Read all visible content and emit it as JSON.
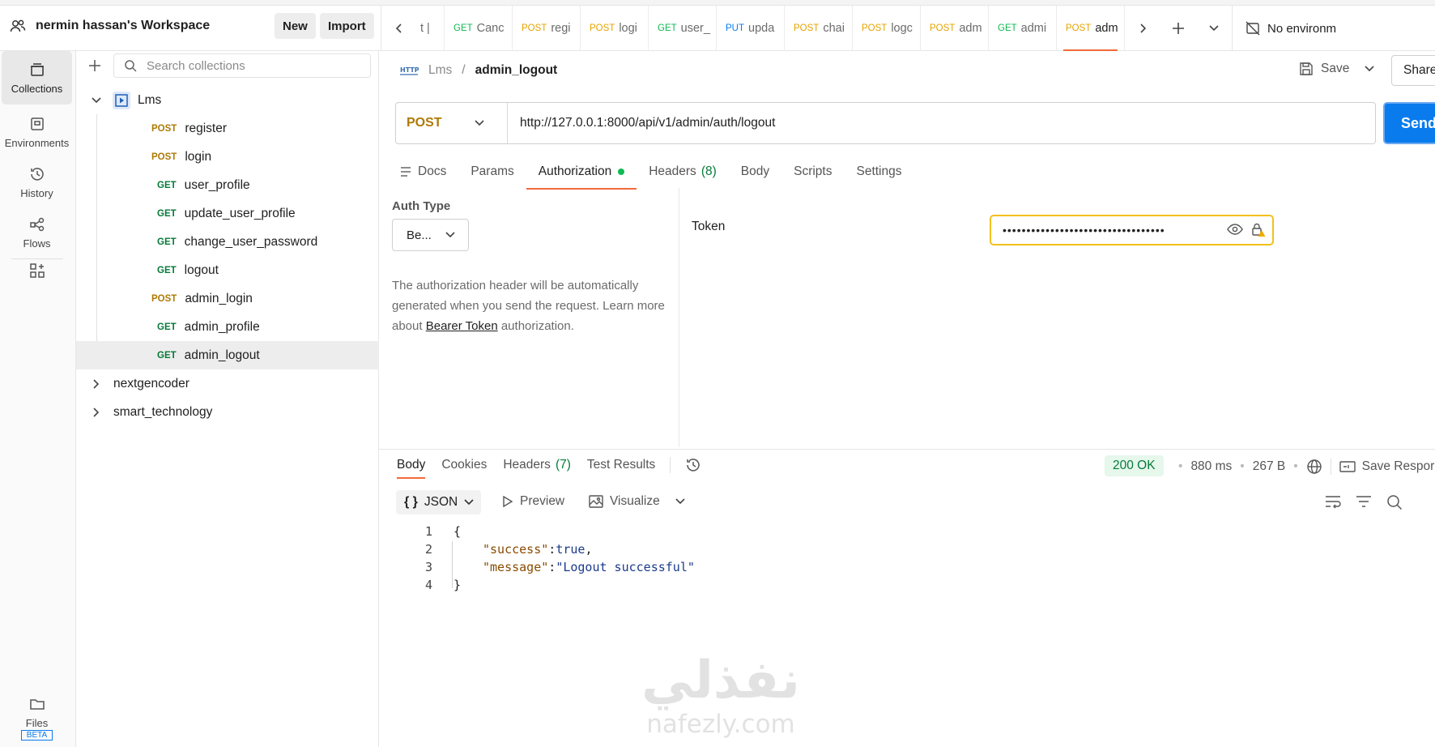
{
  "workspace": {
    "name": "nermin hassan's Workspace",
    "new_label": "New",
    "import_label": "Import"
  },
  "tabs": [
    {
      "method": "",
      "title": "t |"
    },
    {
      "method": "GET",
      "title": "Canc"
    },
    {
      "method": "POST",
      "title": "regi",
      "dot": true
    },
    {
      "method": "POST",
      "title": "logi",
      "dot": true
    },
    {
      "method": "GET",
      "title": "user_",
      "dot": true
    },
    {
      "method": "PUT",
      "title": "upda",
      "dot": true
    },
    {
      "method": "POST",
      "title": "chai",
      "dot": true
    },
    {
      "method": "POST",
      "title": "logc",
      "dot": true
    },
    {
      "method": "POST",
      "title": "adm"
    },
    {
      "method": "GET",
      "title": "admi",
      "dot": true
    },
    {
      "method": "POST",
      "title": "adm",
      "dot": true,
      "active": true
    }
  ],
  "environment": {
    "label": "No environm"
  },
  "rail": {
    "collections": "Collections",
    "environments": "Environments",
    "history": "History",
    "flows": "Flows",
    "files": "Files",
    "files_badge": "BETA"
  },
  "sidebar": {
    "search_placeholder": "Search collections",
    "collection": "Lms",
    "requests": [
      {
        "method": "POST",
        "name": "register"
      },
      {
        "method": "POST",
        "name": "login"
      },
      {
        "method": "GET",
        "name": "user_profile"
      },
      {
        "method": "GET",
        "name": "update_user_profile"
      },
      {
        "method": "GET",
        "name": "change_user_password"
      },
      {
        "method": "GET",
        "name": "logout"
      },
      {
        "method": "POST",
        "name": "admin_login"
      },
      {
        "method": "GET",
        "name": "admin_profile"
      },
      {
        "method": "GET",
        "name": "admin_logout"
      }
    ],
    "other_collections": [
      "nextgencoder",
      "smart_technology"
    ]
  },
  "request": {
    "breadcrumb_parent": "Lms",
    "breadcrumb_sep": "/",
    "breadcrumb_current": "admin_logout",
    "save_label": "Save",
    "share_label": "Share",
    "method": "POST",
    "url": "http://127.0.0.1:8000/api/v1/admin/auth/logout",
    "send_label": "Send",
    "tabs": {
      "docs": "Docs",
      "params": "Params",
      "authorization": "Authorization",
      "headers": "Headers",
      "headers_count": "(8)",
      "body": "Body",
      "scripts": "Scripts",
      "settings": "Settings"
    },
    "auth": {
      "type_label": "Auth Type",
      "type_value": "Be...",
      "desc_1": "The authorization header will be automatically generated when you send the request. Learn more about",
      "desc_link": "Bearer Token",
      "desc_2": "authorization.",
      "token_label": "Token",
      "token_value": "••••••••••••••••••••••••••••••••••"
    }
  },
  "response": {
    "tabs": {
      "body": "Body",
      "cookies": "Cookies",
      "headers": "Headers",
      "headers_count": "(7)",
      "test_results": "Test Results"
    },
    "status": "200 OK",
    "time": "880 ms",
    "size": "267 B",
    "save_label": "Save Respor",
    "format": "JSON",
    "preview_label": "Preview",
    "visualize_label": "Visualize",
    "code": [
      {
        "n": "1",
        "text": "{"
      },
      {
        "n": "2",
        "key": "\"success\"",
        "sep": ": ",
        "val": "true",
        "end": ","
      },
      {
        "n": "3",
        "key": "\"message\"",
        "sep": ": ",
        "str": "\"Logout successful\""
      },
      {
        "n": "4",
        "text": "}"
      }
    ]
  },
  "watermark": {
    "arabic": "نفذلي",
    "latin": "nafezly.com"
  },
  "colors": {
    "accent": "#f26b3a",
    "send": "#097bed",
    "get": "#0cbb52",
    "post": "#ad7a03",
    "put": "#097bed",
    "ok": "#067a3a"
  }
}
